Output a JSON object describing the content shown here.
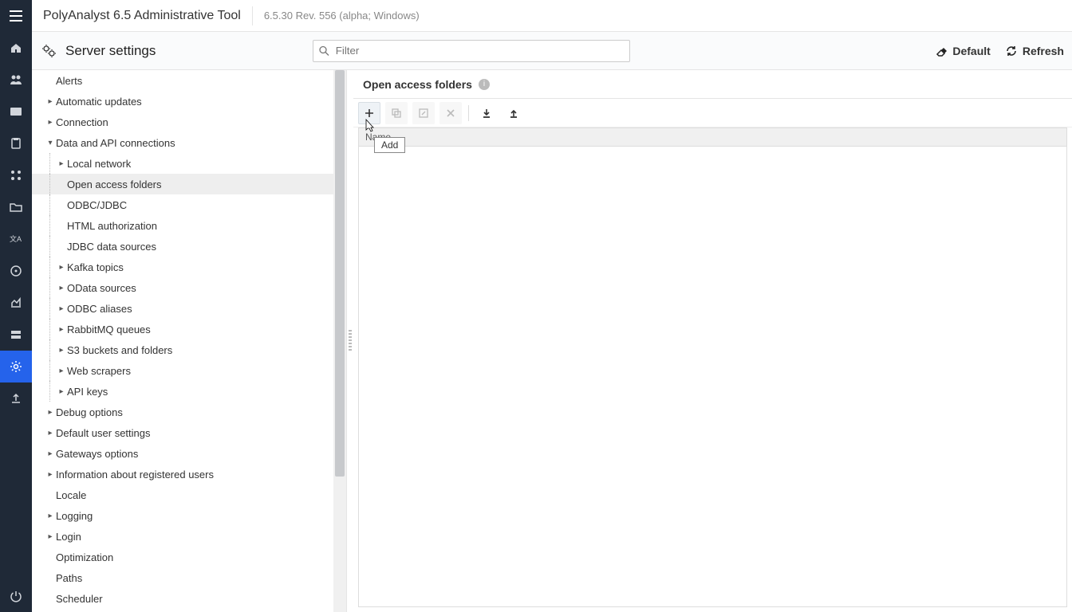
{
  "app": {
    "title": "PolyAnalyst 6.5 Administrative Tool",
    "version": "6.5.30 Rev. 556 (alpha; Windows)"
  },
  "header": {
    "page_title": "Server settings",
    "filter_placeholder": "Filter",
    "default_label": "Default",
    "refresh_label": "Refresh"
  },
  "tree": {
    "items": [
      {
        "label": "Alerts",
        "caret": "",
        "lvl": 0
      },
      {
        "label": "Automatic updates",
        "caret": "right",
        "lvl": 0
      },
      {
        "label": "Connection",
        "caret": "right",
        "lvl": 0
      },
      {
        "label": "Data and API connections",
        "caret": "down",
        "lvl": 0
      },
      {
        "label": "Local network",
        "caret": "right",
        "lvl": 1
      },
      {
        "label": "Open access folders",
        "caret": "",
        "lvl": 1,
        "selected": true
      },
      {
        "label": "ODBC/JDBC",
        "caret": "",
        "lvl": 1
      },
      {
        "label": "HTML authorization",
        "caret": "",
        "lvl": 1
      },
      {
        "label": "JDBC data sources",
        "caret": "",
        "lvl": 1
      },
      {
        "label": "Kafka topics",
        "caret": "right",
        "lvl": 1
      },
      {
        "label": "OData sources",
        "caret": "right",
        "lvl": 1
      },
      {
        "label": "ODBC aliases",
        "caret": "right",
        "lvl": 1
      },
      {
        "label": "RabbitMQ queues",
        "caret": "right",
        "lvl": 1
      },
      {
        "label": "S3 buckets and folders",
        "caret": "right",
        "lvl": 1
      },
      {
        "label": "Web scrapers",
        "caret": "right",
        "lvl": 1
      },
      {
        "label": "API keys",
        "caret": "right",
        "lvl": 1
      },
      {
        "label": "Debug options",
        "caret": "right",
        "lvl": 0
      },
      {
        "label": "Default user settings",
        "caret": "right",
        "lvl": 0
      },
      {
        "label": "Gateways options",
        "caret": "right",
        "lvl": 0
      },
      {
        "label": "Information about registered users",
        "caret": "right",
        "lvl": 0
      },
      {
        "label": "Locale",
        "caret": "",
        "lvl": 0
      },
      {
        "label": "Logging",
        "caret": "right",
        "lvl": 0
      },
      {
        "label": "Login",
        "caret": "right",
        "lvl": 0
      },
      {
        "label": "Optimization",
        "caret": "",
        "lvl": 0
      },
      {
        "label": "Paths",
        "caret": "",
        "lvl": 0
      },
      {
        "label": "Scheduler",
        "caret": "",
        "lvl": 0
      }
    ]
  },
  "detail": {
    "title": "Open access folders",
    "grid_col": "Name",
    "tooltip": "Add"
  }
}
